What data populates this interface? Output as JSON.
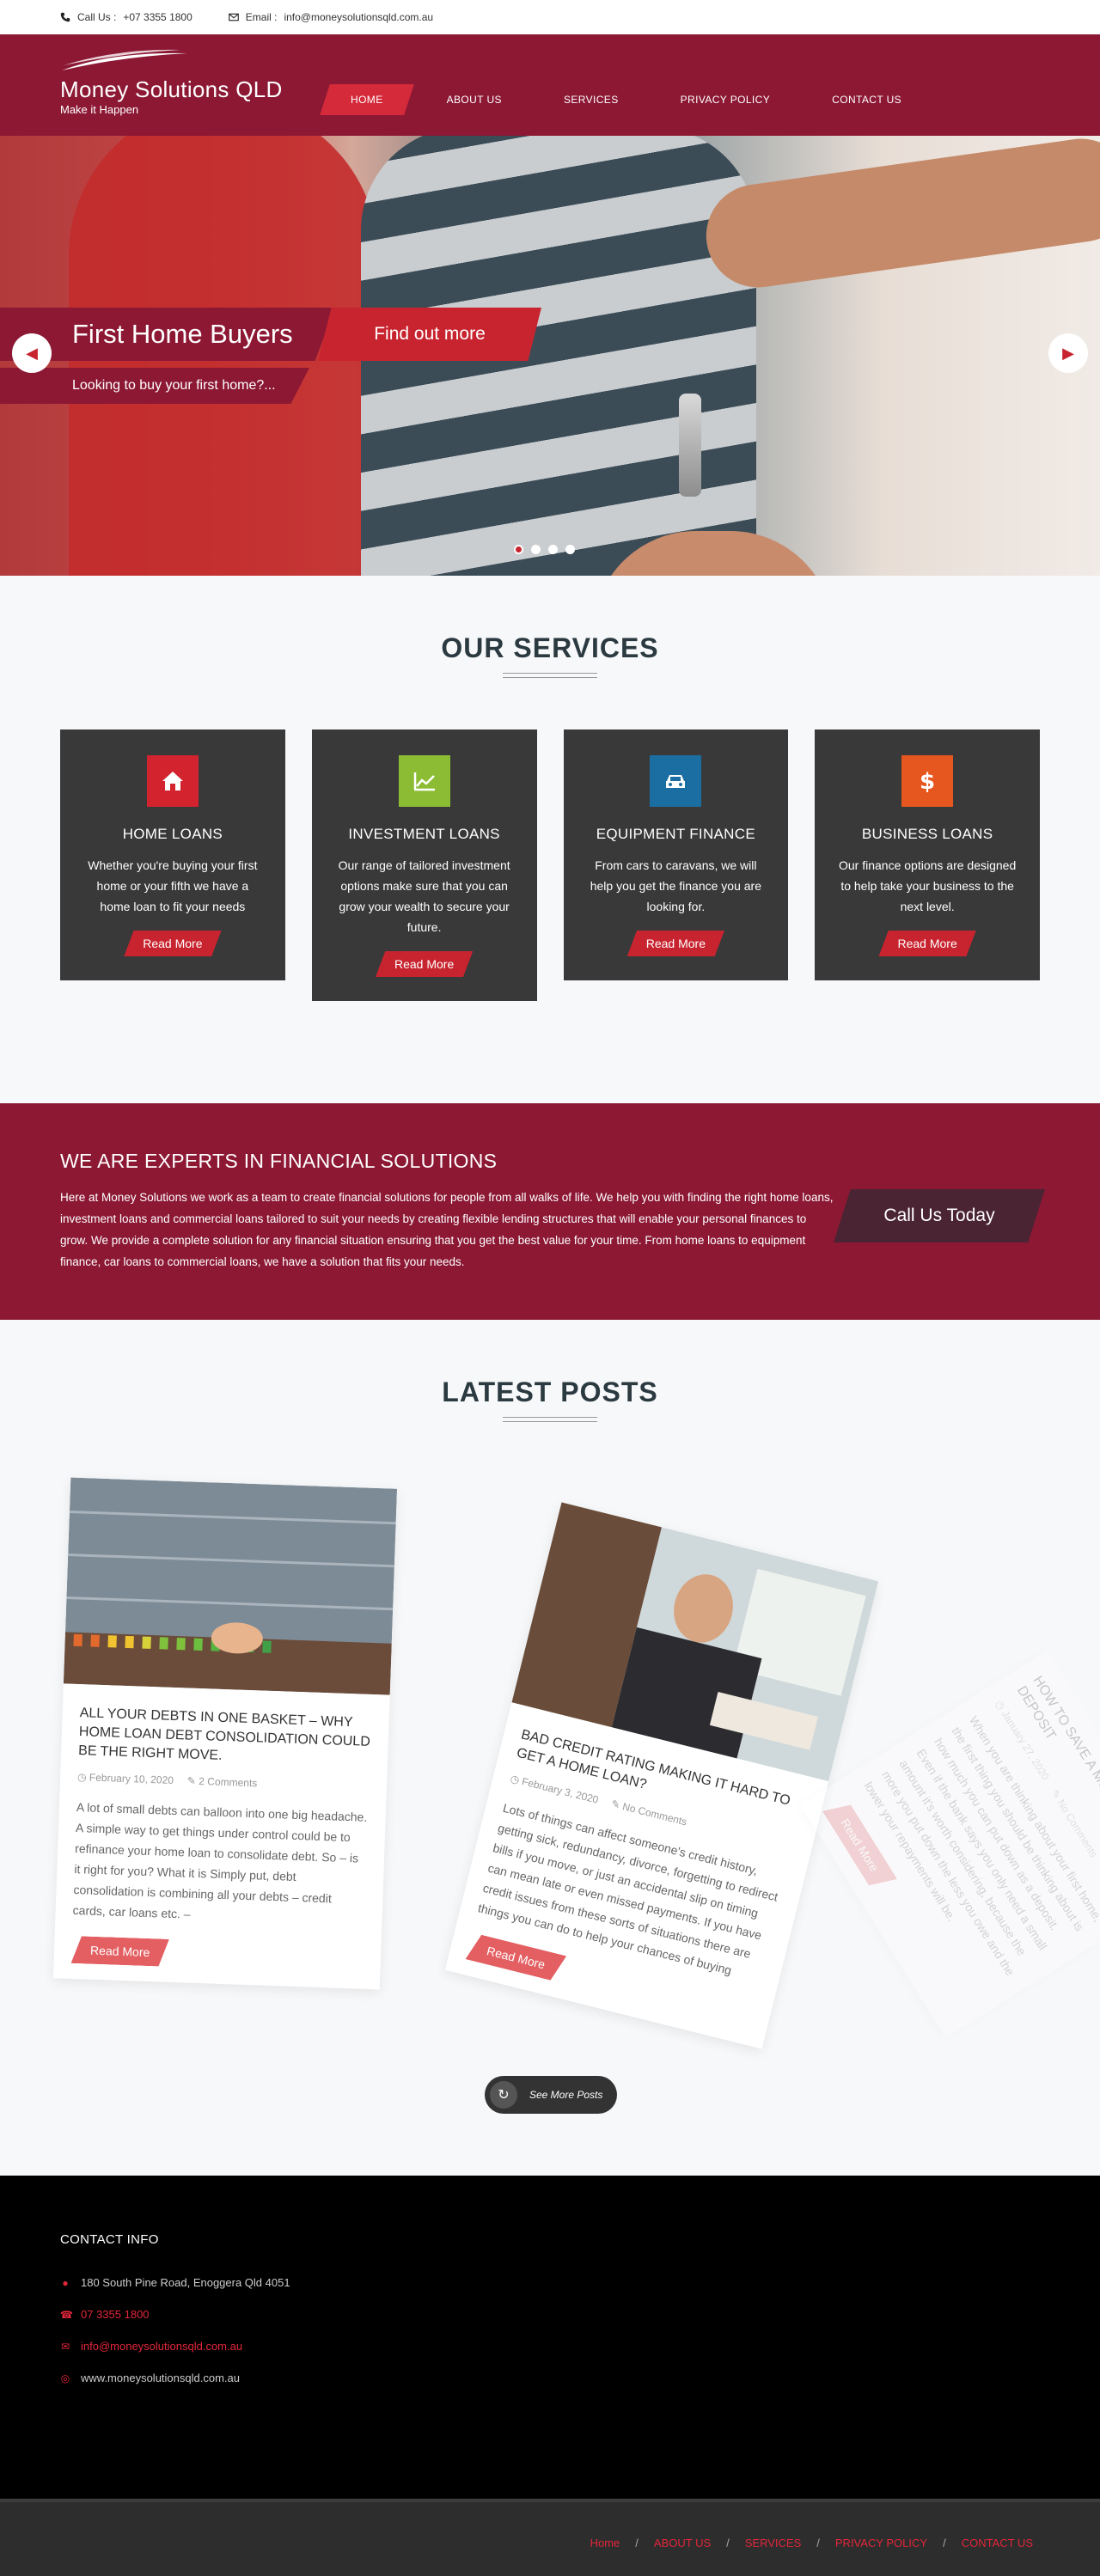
{
  "topbar": {
    "phone_label": "Call Us :",
    "phone": "+07 3355 1800",
    "email_label": "Email :",
    "email": "info@moneysolutionsqld.com.au"
  },
  "brand": {
    "name": "Money Solutions QLD",
    "tagline": "Make it Happen"
  },
  "nav": {
    "items": [
      {
        "label": "HOME",
        "active": true
      },
      {
        "label": "ABOUT US"
      },
      {
        "label": "SERVICES"
      },
      {
        "label": "PRIVACY POLICY"
      },
      {
        "label": "CONTACT US"
      }
    ]
  },
  "hero": {
    "title": "First Home Buyers",
    "cta": "Find out more",
    "subtitle": "Looking to buy your first home?...",
    "slide_count": 4,
    "active_slide": 1
  },
  "services": {
    "title": "OUR SERVICES",
    "items": [
      {
        "name": "HOME LOANS",
        "icon": "home-icon",
        "color": "#d2232f",
        "text": "Whether you're buying your first home or your fifth we have a home loan to fit your needs",
        "button": "Read More"
      },
      {
        "name": "INVESTMENT LOANS",
        "icon": "chart-line-icon",
        "color": "#8cbc34",
        "text": "Our range of tailored investment options make sure that you can grow your wealth to secure your future.",
        "button": "Read More"
      },
      {
        "name": "EQUIPMENT FINANCE",
        "icon": "car-icon",
        "color": "#1b6ea1",
        "text": "From cars to caravans, we will help you get the finance you are looking for.",
        "button": "Read More"
      },
      {
        "name": "BUSINESS LOANS",
        "icon": "dollar-icon",
        "color": "#e5571f",
        "text": "Our finance options are designed to help take your business to the next level.",
        "button": "Read More"
      }
    ]
  },
  "experts": {
    "title": "WE ARE EXPERTS IN FINANCIAL SOLUTIONS",
    "body": "Here at Money Solutions we work as a team to create financial solutions for people from all walks of life. We help you with finding the right home loans, investment loans and commercial loans tailored to suit your needs by creating flexible lending structures that will enable your personal finances to grow. We provide a complete solution for any financial situation ensuring that you get the best value for your time. From home loans to equipment finance, car loans to commercial loans, we have a solution that fits your needs.",
    "cta": "Call Us Today"
  },
  "posts": {
    "title": "LATEST POSTS",
    "items": [
      {
        "title": "ALL YOUR DEBTS IN ONE BASKET – WHY HOME LOAN DEBT CONSOLIDATION COULD BE THE RIGHT MOVE.",
        "date": "February 10, 2020",
        "comments": "2 Comments",
        "excerpt": "A lot of small debts can balloon into one big headache. A simple way to get things under control could be to refinance your home loan to consolidate debt. So – is it right for you? What it is Simply put, debt consolidation is combining all your debts – credit cards, car loans etc. –",
        "button": "Read More"
      },
      {
        "title": "BAD CREDIT RATING MAKING IT HARD TO GET A HOME LOAN?",
        "date": "February 3, 2020",
        "comments": "No Comments",
        "excerpt": "Lots of things can affect someone's credit history, getting sick, redundancy, divorce, forgetting to redirect bills if you move, or just an accidental slip on timing can mean late or even missed payments. If you have credit issues from these sorts of situations there are things you can do to help your chances of buying",
        "button": "Read More"
      },
      {
        "title": "HOW TO SAVE A MUCH LARGER DEPOSIT",
        "date": "January 27, 2020",
        "comments": "No Comments",
        "excerpt": "When you are thinking about your first home, the first thing you should be thinking about is how much you can put down as a deposit. Even if the bank says you only need a small amount it's worth considering, because the more you put down the less you owe and the lower your repayments will be.",
        "button": "Read More"
      }
    ],
    "more": "See More Posts"
  },
  "footer": {
    "title": "CONTACT INFO",
    "address": "180 South Pine Road, Enoggera Qld 4051",
    "phone": "07 3355 1800",
    "email": "info@moneysolutionsqld.com.au",
    "website": "www.moneysolutionsqld.com.au"
  },
  "bottom_nav": [
    "Home",
    "ABOUT US",
    "SERVICES",
    "PRIVACY POLICY",
    "CONTACT US"
  ]
}
